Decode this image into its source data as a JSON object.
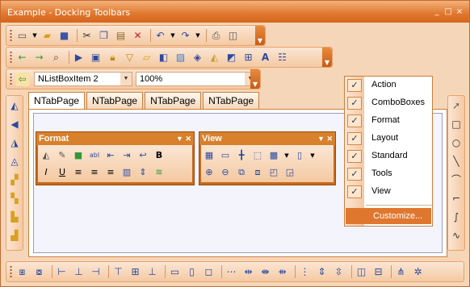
{
  "window": {
    "title": "Example - Docking Toolbars",
    "buttons": {
      "minimize": "_",
      "maximize": "□",
      "close": "×"
    }
  },
  "standard_toolbar": {
    "icons": [
      "new-icon",
      "dropdown-arrow-icon",
      "open-icon",
      "save-icon",
      "cut-icon",
      "copy-icon",
      "paste-icon",
      "delete-icon",
      "undo-icon",
      "undo-dropdown-icon",
      "redo-icon",
      "redo-dropdown-icon",
      "print-icon",
      "print-preview-icon"
    ]
  },
  "action_toolbar": {
    "icons": [
      "back-icon",
      "forward-icon",
      "find-icon",
      "play-icon",
      "window-icon",
      "lock-icon",
      "filter-icon",
      "folder-open-icon",
      "stack-icon",
      "image-icon",
      "cube-icon",
      "bucket-icon",
      "fill-icon",
      "tree-icon",
      "font-icon",
      "properties-icon"
    ]
  },
  "combo_toolbar": {
    "list_value": "NListBoxItem 2",
    "zoom_value": "100%"
  },
  "tabs": [
    "NTabPage",
    "NTabPage",
    "NTabPage",
    "NTabPage"
  ],
  "format_panel": {
    "title": "Format",
    "row1": [
      "paint-bucket-icon",
      "pencil-icon",
      "color-icon",
      "textbox-icon",
      "align-left-arrows-icon",
      "align-right-arrows-icon",
      "wrap-icon",
      "bold-icon"
    ],
    "row2": [
      "italic-icon",
      "underline-icon",
      "align-left-icon",
      "align-center-icon",
      "align-right-icon",
      "column-icon",
      "spacing-icon",
      "layers-icon"
    ],
    "bold_text": "B",
    "italic_text": "I",
    "underline_text": "U"
  },
  "view_panel": {
    "title": "View",
    "row1": [
      "grid-icon",
      "ruler-icon",
      "guides-icon",
      "selection-icon",
      "grid-dropdown-icon",
      "page-icon"
    ],
    "row2": [
      "zoom-in-icon",
      "zoom-out-icon",
      "group-icon",
      "ungroup-icon",
      "bring-front-icon",
      "send-back-icon"
    ]
  },
  "toolbars_menu": {
    "items": [
      {
        "label": "Action",
        "checked": true
      },
      {
        "label": "ComboBoxes",
        "checked": true
      },
      {
        "label": "Format",
        "checked": true
      },
      {
        "label": "Layout",
        "checked": true
      },
      {
        "label": "Standard",
        "checked": true
      },
      {
        "label": "Tools",
        "checked": true
      },
      {
        "label": "View",
        "checked": true
      }
    ],
    "customize": "Customize..."
  },
  "colors": {
    "titlebar": "#e0772e",
    "toolbar_bg": "#f6d6b8",
    "panel_header": "#d8802c",
    "highlight": "#e0772e"
  }
}
